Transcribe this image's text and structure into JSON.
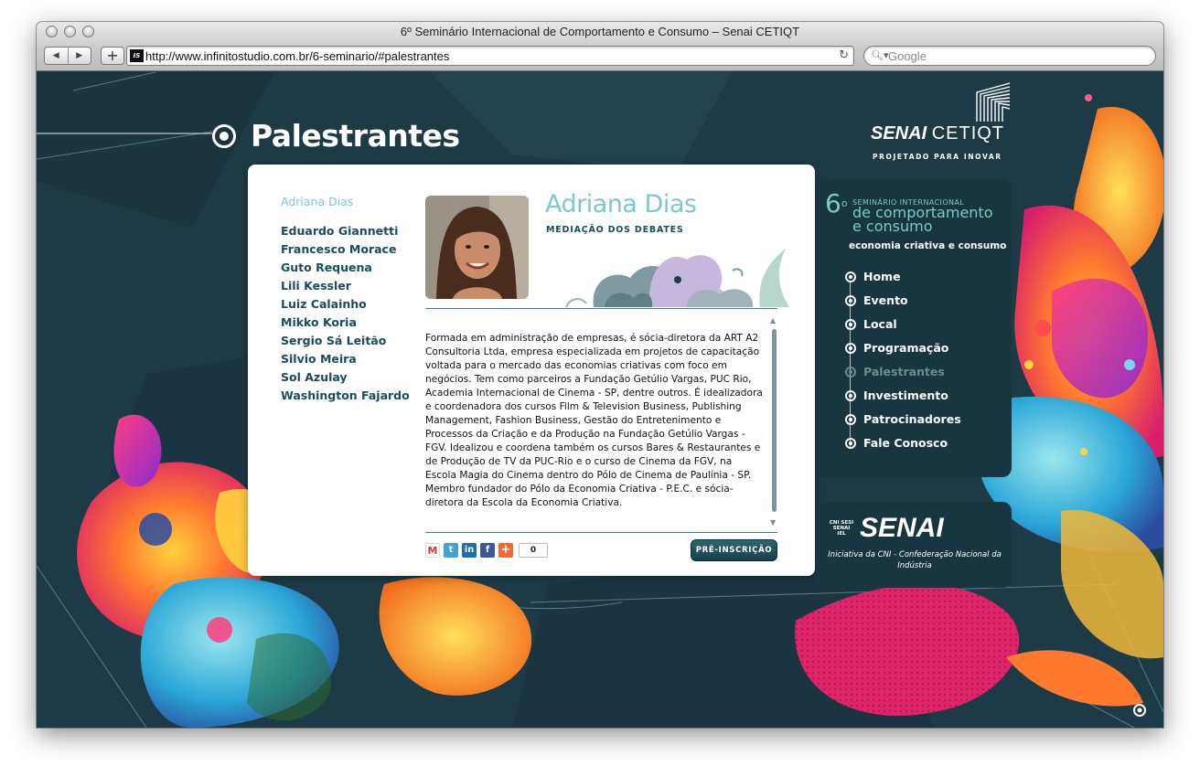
{
  "browser": {
    "window_title": "6º Seminário Internacional de Comportamento e Consumo – Senai CETIQT",
    "url": "http://www.infinitostudio.com.br/6-seminario/#palestrantes",
    "search_placeholder": "Google",
    "favicon_text": "IS"
  },
  "page": {
    "section_title": "Palestrantes"
  },
  "logo": {
    "senai": "SENAI",
    "cetiqt": "CETIQT",
    "tagline": "PROJETADO PARA INOVAR"
  },
  "speakers": {
    "active": "Adriana Dias",
    "list": [
      "Eduardo Giannetti",
      "Francesco Morace",
      "Guto Requena",
      "Lili Kessler",
      "Luiz Calainho",
      "Mikko Koria",
      "Sergio Sá Leitão",
      "Silvio Meira",
      "Sol Azulay",
      "Washington Fajardo"
    ]
  },
  "profile": {
    "name": "Adriana Dias",
    "role": "MEDIAÇÃO DOS DEBATES",
    "bio": "Formada em administração de empresas, é sócia-diretora da ART A2 Consultoria Ltda, empresa especializada em projetos de capacitação voltada para o mercado das economias criativas com foco em negócios. Tem como parceiros a Fundação Getúlio Vargas, PUC Rio, Academia Internacional de Cinema - SP, dentre outros. É idealizadora e coordenadora dos cursos Film & Television Business, Publishing Management, Fashion Business, Gestão do Entretenimento e Processos da Criação e da Produção na Fundação Getúlio Vargas - FGV. Idealizou e coordena também os cursos Bares & Restaurantes e de Produção de TV da PUC-Rio e o curso de Cinema da FGV, na Escola Magia do Cinema dentro do Pólo de Cinema de Paulínia - SP. Membro fundador do Pólo da Economia Criativa - P.E.C. e sócia-diretora da Escola da Economia Criativa.",
    "share_count": "0",
    "pre_button": "PRÉ-INSCRIÇÃO"
  },
  "event": {
    "number": "6",
    "ordinal": "o",
    "line1": "SEMINÁRIO INTERNACIONAL",
    "line2": "de comportamento",
    "line3": "e consumo",
    "subtitle": "economia criativa e consumo"
  },
  "menu": {
    "items": [
      "Home",
      "Evento",
      "Local",
      "Programação",
      "Palestrantes",
      "Investimento",
      "Patrocinadores",
      "Fale Conosco"
    ],
    "active": "Palestrantes"
  },
  "senai_box": {
    "mini": "CNI SESI SENAI IEL",
    "word": "SENAI",
    "caption": "Iniciativa da CNI - Confederação Nacional da Indústria"
  },
  "colors": {
    "background": "#1d3b47",
    "accent_teal": "#7cc9cc",
    "dark_teal": "#1c4b5a",
    "panel": "#173640"
  },
  "icons": {
    "nav_back": "chevron-left-icon",
    "nav_forward": "chevron-right-icon",
    "reload": "reload-icon",
    "search": "search-icon",
    "share": [
      "gmail-icon",
      "twitter-icon",
      "linkedin-icon",
      "facebook-icon",
      "plus-share-icon"
    ]
  }
}
